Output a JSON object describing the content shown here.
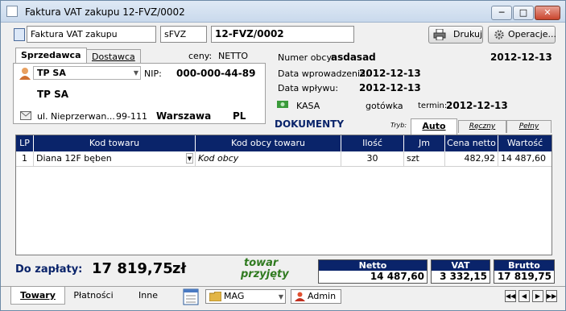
{
  "window": {
    "title": "Faktura VAT zakupu 12-FVZ/0002"
  },
  "doc": {
    "type": "Faktura VAT zakupu",
    "series": "sFVZ",
    "number": "12-FVZ/0002"
  },
  "toolbar": {
    "print_label": "Drukuj",
    "operations_label": "Operacje..."
  },
  "party_tabs": {
    "seller": "Sprzedawca",
    "buyer": "Dostawca"
  },
  "prices": {
    "label": "ceny:",
    "value": "NETTO"
  },
  "seller": {
    "code": "TP SA",
    "nip_label": "NIP:",
    "nip": "000-000-44-89",
    "name": "TP SA",
    "street": "ul. Nieprzerwan...",
    "postcode": "99-111",
    "city": "Warszawa",
    "country": "PL"
  },
  "info": {
    "foreign_no_label": "Numer obcy:",
    "foreign_no": "asdasad",
    "date_top": "2012-12-13",
    "entry_label": "Data wprowadzenia:",
    "entry_date": "2012-12-13",
    "receipt_label": "Data wpływu:",
    "receipt_date": "2012-12-13",
    "cash": "KASA",
    "payment": "gotówka",
    "term_label": "termin:",
    "term": "2012-12-13"
  },
  "documents_label": "DOKUMENTY",
  "mode_tabs": [
    "Tryb:",
    "Auto",
    "Ręczny",
    "Pełny"
  ],
  "grid": {
    "headers": [
      "LP",
      "Kod towaru",
      "Kod obcy towaru",
      "Ilość",
      "Jm",
      "Cena netto",
      "Wartość netto"
    ],
    "rows": [
      [
        "1",
        "Diana 12F bęben",
        "Kod obcy",
        "30",
        "szt",
        "482,92",
        "14 487,60"
      ]
    ]
  },
  "payment": {
    "label": "Do zapłaty:",
    "amount": "17 819,75",
    "currency": "zł",
    "stamp_line1": "towar",
    "stamp_line2": "przyjęty"
  },
  "totals": {
    "netto_label": "Netto",
    "netto": "14 487,60",
    "vat_label": "VAT",
    "vat": "3 332,15",
    "brutto_label": "Brutto",
    "brutto": "17 819,75"
  },
  "bottom_tabs": [
    "Towary",
    "Płatności",
    "Inne"
  ],
  "warehouse": "MAG",
  "user": "Admin",
  "icons": [
    "document-icon",
    "printer-icon",
    "gear-icon",
    "person-icon",
    "envelope-icon",
    "cash-icon",
    "notepad-icon",
    "folder-icon",
    "user-icon"
  ]
}
